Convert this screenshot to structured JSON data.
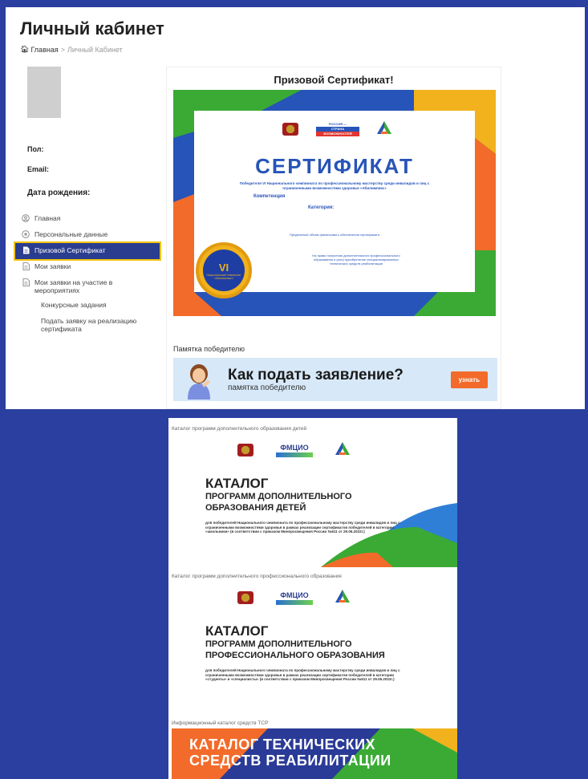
{
  "header": {
    "title": "Личный кабинет",
    "breadcrumb_home": "Главная",
    "breadcrumb_separator": ">",
    "breadcrumb_current": "Личный Кабинет"
  },
  "profile": {
    "gender_label": "Пол:",
    "email_label": "Email:",
    "birthdate_label": "Дата рождения:"
  },
  "menu": {
    "items": [
      {
        "label": "Главная",
        "icon": "user-circle-icon"
      },
      {
        "label": "Персональные данные",
        "icon": "gear-icon"
      },
      {
        "label": "Призовой Сертификат",
        "icon": "document-icon",
        "active": true
      },
      {
        "label": "Мои заявки",
        "icon": "document-icon"
      },
      {
        "label": "Мои заявки на участие в мероприятиях",
        "icon": "document-icon"
      },
      {
        "label": "Конкурсные задания"
      },
      {
        "label": "Подать заявку на реализацию сертификата"
      }
    ]
  },
  "certificate": {
    "section_title": "Призовой Сертификат!",
    "logo_text_1": "РОССИЯ —",
    "logo_text_2": "СТРАНА",
    "logo_text_3": "ВОЗМОЖНОСТЕЙ",
    "heading": "СЕРТИФИКАТ",
    "subtitle": "Победителя VI Национального чемпионата по профессиональному мастерству среди инвалидов и лиц с ограниченными возможностями здоровья «Абилимпикс»",
    "competence_label": "Компетенция",
    "category_label": "Категория:",
    "finance_text": "Предельный объем финансового обеспечения сертификата",
    "right_text": "На право получения дополнительного профессионального образования и (или) приобретение специализированных технических средств реабилитации",
    "medal_number": "VI",
    "medal_text": "Национальный чемпионат «Абилимпикс»",
    "colors": {
      "blue": "#2754b8",
      "orange": "#f26b2a",
      "green": "#3aaa35",
      "yellow": "#f1b21d"
    }
  },
  "memo": {
    "label": "Памятка победителю",
    "title": "Как подать заявление?",
    "subtitle": "памятка победителю",
    "button": "узнать"
  },
  "catalogs": [
    {
      "label": "Каталог программ дополнительного образования детей",
      "title_big": "КАТАЛОГ",
      "title_line_1": "ПРОГРАММ ДОПОЛНИТЕЛЬНОГО",
      "title_line_2": "ОБРАЗОВАНИЯ ДЕТЕЙ",
      "small_text": "для победителей Национального чемпионата по профессиональному мастерству среди инвалидов и лиц с ограниченными возможностями здоровья в рамках реализации сертификатов победителей в категории «школьники» (в соответствии с приказом Минпросвещения России №511 от 29.06.2022г.)"
    },
    {
      "label": "Каталог программ дополнительного профессионального образования",
      "title_big": "КАТАЛОГ",
      "title_line_1": "ПРОГРАММ ДОПОЛНИТЕЛЬНОГО",
      "title_line_2": "ПРОФЕССИОНАЛЬНОГО ОБРАЗОВАНИЯ",
      "small_text": "для победителей Национального чемпионата по профессиональному мастерству среди инвалидов и лиц с ограниченными возможностями здоровья в рамках реализации сертификатов победителей в категории «студенты» и «специалисты» (в соответствии с приказом Минпросвещения России №511 от 29.06.2022г.)"
    }
  ],
  "fmcio_label": "ФМЦИО",
  "tsr": {
    "label": "Информационный каталог средств ТСР",
    "line_1": "КАТАЛОГ ТЕХНИЧЕСКИХ",
    "line_2": "СРЕДСТВ РЕАБИЛИТАЦИИ"
  }
}
